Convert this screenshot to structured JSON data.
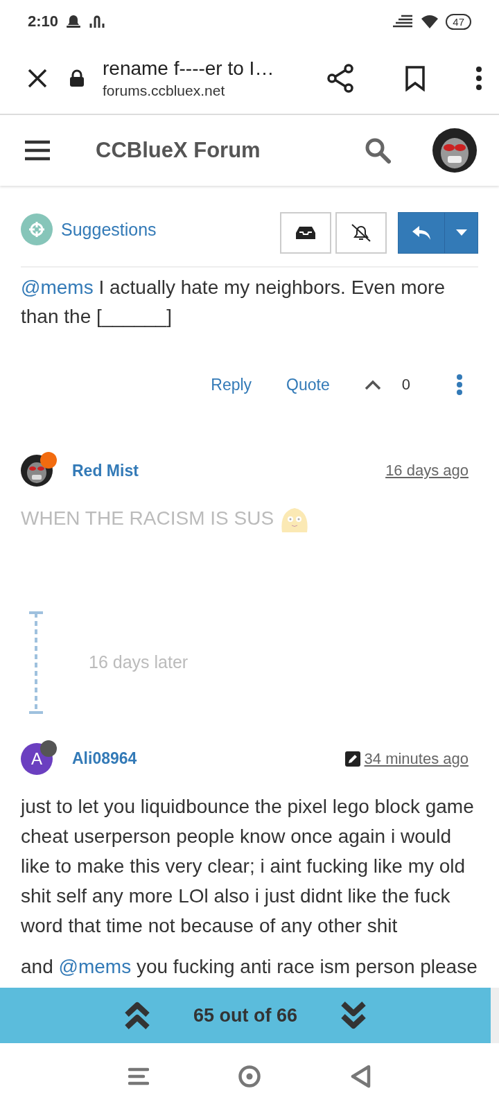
{
  "status_bar": {
    "time": "2:10",
    "battery": "47"
  },
  "browser": {
    "page_title": "rename f----er to I…",
    "url": "forums.ccbluex.net"
  },
  "forum_header": {
    "title": "CCBlueX Forum"
  },
  "topic": {
    "category": "Suggestions"
  },
  "posts": [
    {
      "kind": "continued",
      "paragraphs": [
        [
          {
            "kind": "mention",
            "text": "@mems"
          },
          {
            "kind": "text",
            "text": " I actually hate my neighbors. Even more than the [______]"
          }
        ]
      ],
      "actions": {
        "reply": "Reply",
        "quote": "Quote",
        "votes": "0"
      }
    },
    {
      "kind": "full",
      "author": "Red Mist",
      "avatar": {
        "kind": "image"
      },
      "color": "#f26b0f",
      "time": "16 days ago",
      "deleted": true,
      "emoji": true,
      "paragraphs": [
        [
          {
            "kind": "text",
            "text": "WHEN THE RACISM IS SUS"
          }
        ]
      ]
    },
    {
      "kind": "gap",
      "text": "16 days later"
    },
    {
      "kind": "full",
      "author": "Ali08964",
      "avatar": {
        "kind": "letter",
        "letter": "A",
        "color": "#6b3fc0"
      },
      "color": "#555555",
      "time": "34 minutes ago",
      "edited": true,
      "paragraphs": [
        [
          {
            "kind": "text",
            "text": "just to let you liquidbounce the pixel lego block game cheat userperson people know once again i would like to make this very clear; i aint fucking like my old shit self any more LOl also i just didnt like the fuck word that time not because of any other shit"
          }
        ],
        [
          {
            "kind": "text",
            "text": "and "
          },
          {
            "kind": "mention",
            "text": "@mems"
          },
          {
            "kind": "text",
            "text": " you fucking anti race ism person please"
          }
        ]
      ]
    }
  ],
  "pager": {
    "text": "65 out of 66"
  }
}
